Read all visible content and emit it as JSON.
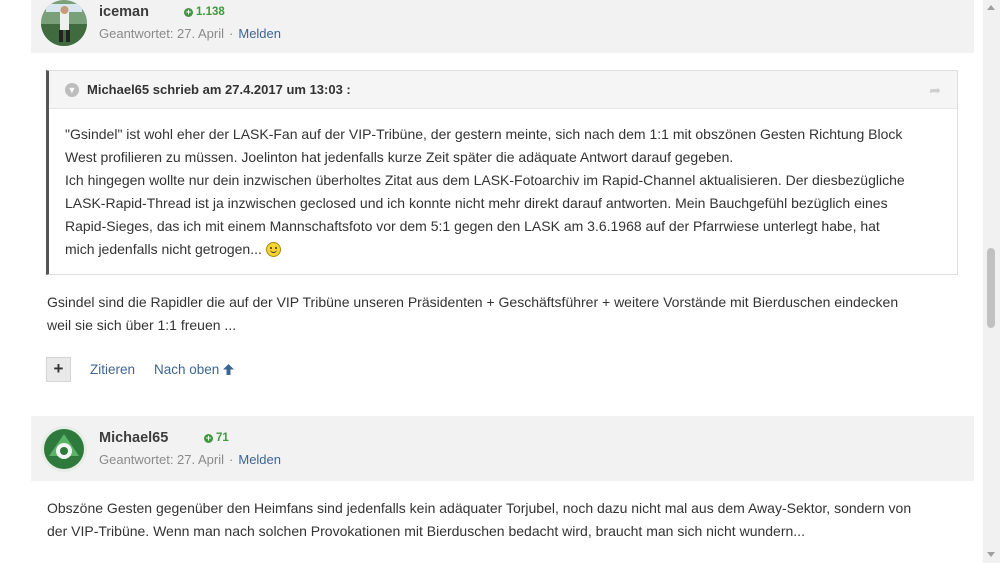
{
  "posts": [
    {
      "author": "iceman",
      "reputation": "1.138",
      "answered": "Geantwortet: 27. April",
      "report_label": "Melden",
      "quote": {
        "header": "Michael65 schrieb am 27.4.2017 um 13:03 :",
        "lines": [
          "\"Gsindel\" ist wohl eher der LASK-Fan auf der VIP-Tribüne, der gestern meinte, sich nach dem 1:1 mit obszönen Gesten Richtung Block",
          "West profilieren zu müssen. Joelinton hat jedenfalls kurze Zeit später die adäquate Antwort darauf gegeben.",
          "Ich hingegen wollte nur dein inzwischen überholtes Zitat aus dem LASK-Fotoarchiv im Rapid-Channel aktualisieren. Der diesbezügliche",
          "LASK-Rapid-Thread ist ja inzwischen geclosed und ich konnte nicht mehr direkt darauf antworten. Mein Bauchgefühl bezüglich eines",
          "Rapid-Sieges, das ich mit einem Mannschaftsfoto  vor dem 5:1 gegen den LASK am 3.6.1968 auf der Pfarrwiese unterlegt habe, hat",
          "mich jedenfalls nicht getrogen..."
        ]
      },
      "text_lines": [
        "Gsindel sind die Rapidler die auf der VIP Tribüne unseren Präsidenten + Geschäftsführer + weitere Vorstände mit Bierduschen eindecken",
        "weil sie sich über 1:1 freuen ..."
      ],
      "actions": {
        "plus": "+",
        "quote": "Zitieren",
        "top": "Nach oben"
      }
    },
    {
      "author": "Michael65",
      "reputation": "71",
      "answered": "Geantwortet: 27. April",
      "report_label": "Melden",
      "text_lines": [
        "Obszöne Gesten gegenüber den Heimfans sind jedenfalls kein adäquater Torjubel, noch dazu nicht mal aus dem Away-Sektor, sondern von",
        "der VIP-Tribüne. Wenn man nach solchen Provokationen mit Bierduschen bedacht wird, braucht man sich nicht wundern..."
      ]
    }
  ],
  "icons": {
    "reputation": "plus-circle-icon",
    "quote_toggle": "chevron-down-icon",
    "share": "share-arrow-icon",
    "up": "arrow-up-icon",
    "smiley": "smiley-icon"
  },
  "colors": {
    "link": "#3d6594",
    "reputation": "#3e9a3e",
    "header_bg": "#f2f2f2"
  }
}
